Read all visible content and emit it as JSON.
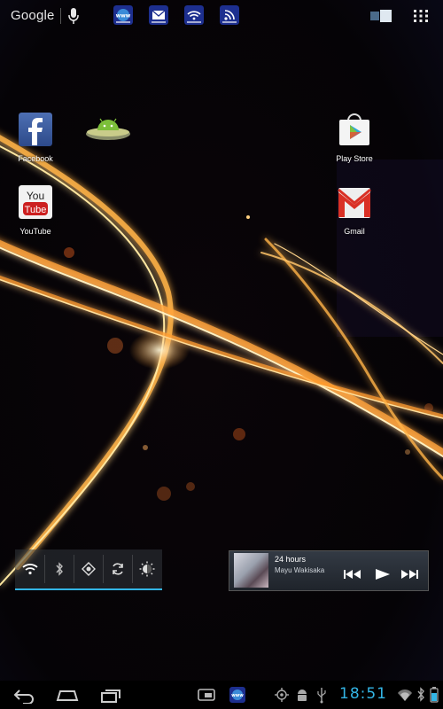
{
  "search": {
    "brand": "Google"
  },
  "apps": {
    "facebook": {
      "label": "Facebook"
    },
    "youtube": {
      "label": "YouTube",
      "glyph_top": "You",
      "glyph_bottom": "Tube"
    },
    "play_store": {
      "label": "Play Store"
    },
    "gmail": {
      "label": "Gmail"
    }
  },
  "music_widget": {
    "title": "24 hours",
    "artist": "Mayu Wakisaka"
  },
  "status": {
    "time": "18:51"
  },
  "colors": {
    "accent": "#33b5e5",
    "wallpaper_glow": "#ffb347"
  },
  "icons": [
    "mic-icon",
    "browser-icon",
    "email-icon",
    "wifi-icon",
    "rss-icon",
    "widget-preview-icon",
    "all-apps-icon",
    "back-icon",
    "home-icon",
    "recents-icon",
    "screenshot-icon",
    "gps-icon",
    "debug-icon",
    "usb-icon",
    "signal-icon",
    "bluetooth-icon"
  ]
}
